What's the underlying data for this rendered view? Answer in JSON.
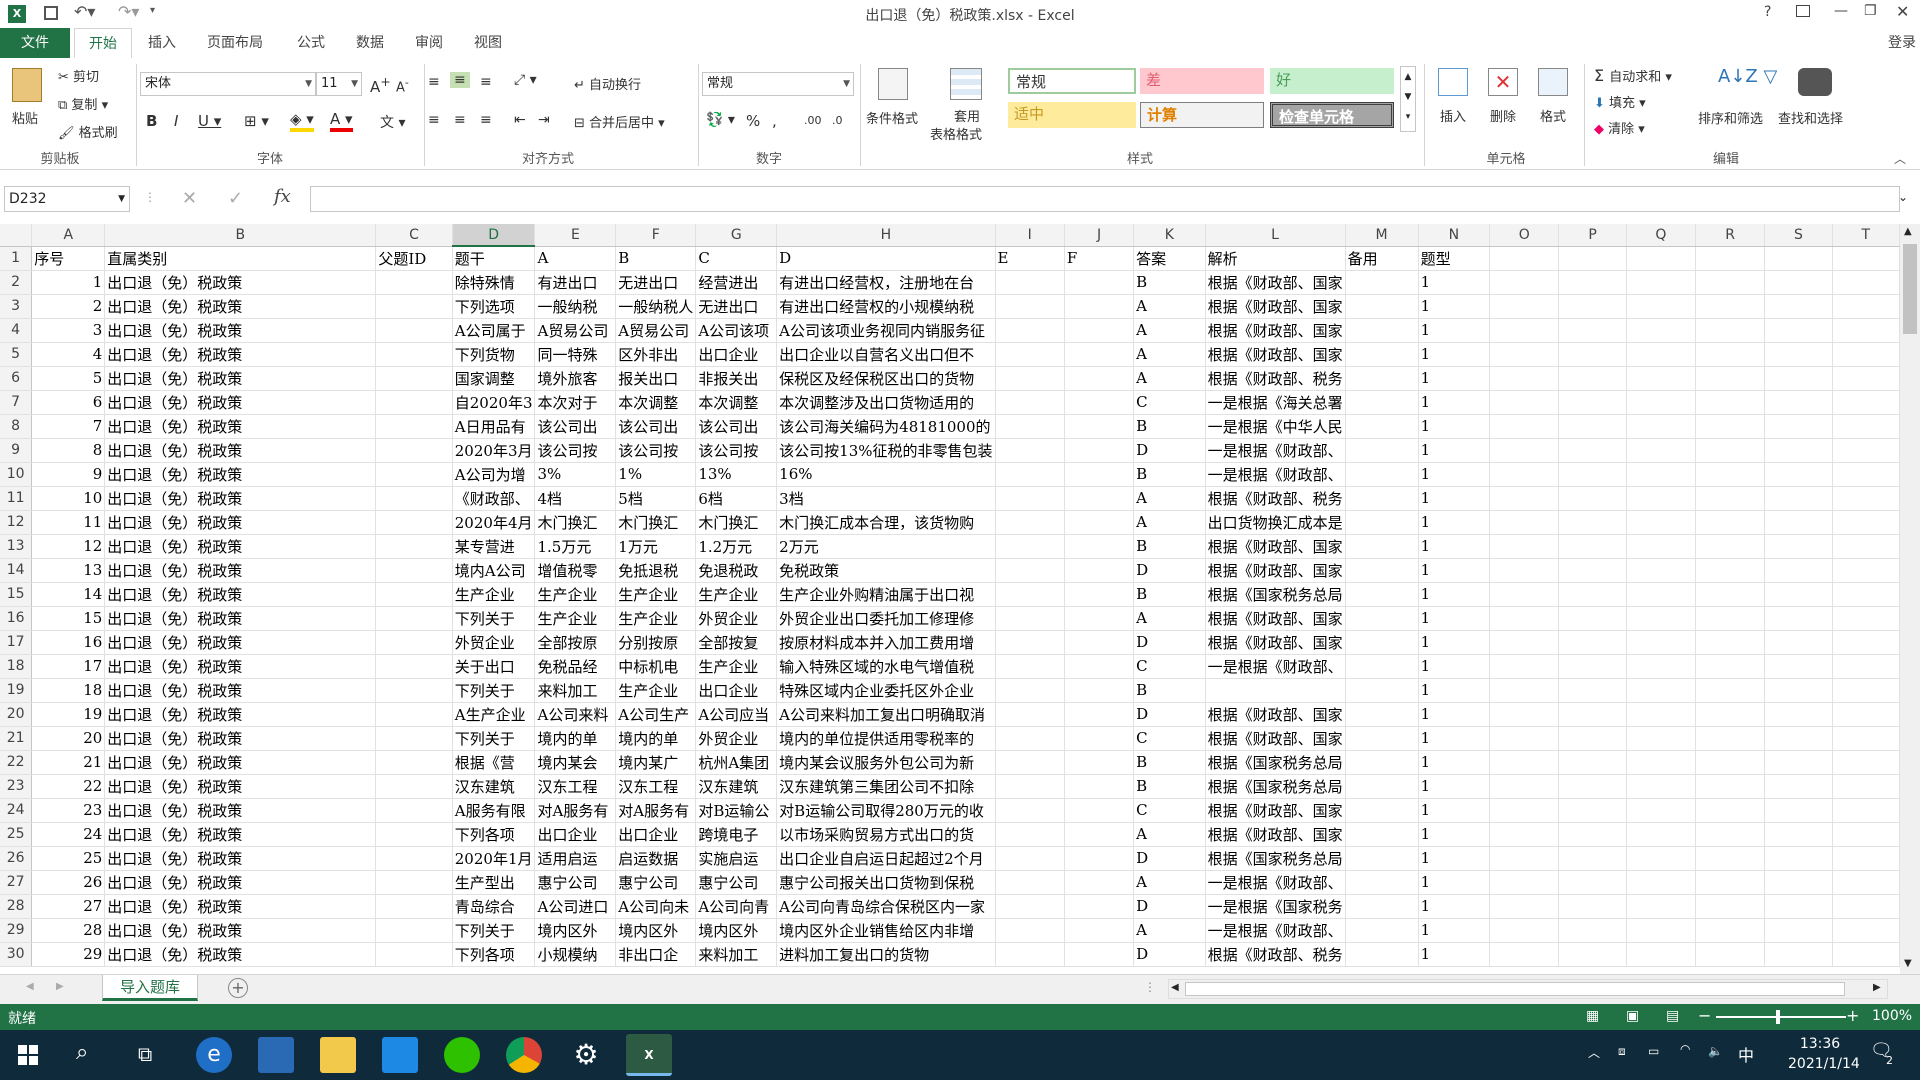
{
  "window": {
    "title": "出口退（免）税政策.xlsx - Excel",
    "signin": "登录"
  },
  "ribbon_tabs": [
    "文件",
    "开始",
    "插入",
    "页面布局",
    "公式",
    "数据",
    "审阅",
    "视图"
  ],
  "clipboard": {
    "paste": "粘贴",
    "cut": "剪切",
    "copy": "复制",
    "format_painter": "格式刷",
    "label": "剪贴板"
  },
  "font": {
    "name": "宋体",
    "size": "11",
    "label": "字体"
  },
  "alignment": {
    "wrap": "自动换行",
    "merge": "合并后居中",
    "label": "对齐方式"
  },
  "number": {
    "format": "常规",
    "label": "数字"
  },
  "styles": {
    "cond_format": "条件格式",
    "table_format_1": "套用",
    "table_format_2": "表格格式",
    "normal": "常规",
    "bad": "差",
    "good": "好",
    "neutral": "适中",
    "calc": "计算",
    "check": "检查单元格",
    "label": "样式"
  },
  "cells": {
    "insert": "插入",
    "delete": "删除",
    "format": "格式",
    "label": "单元格"
  },
  "editing": {
    "autosum": "自动求和",
    "fill": "填充",
    "clear": "清除",
    "sort": "排序和筛选",
    "find": "查找和选择",
    "label": "编辑"
  },
  "formula_bar": {
    "name_box": "D232",
    "value": ""
  },
  "columns": [
    "A",
    "B",
    "C",
    "D",
    "E",
    "F",
    "G",
    "H",
    "I",
    "J",
    "K",
    "L",
    "M",
    "N",
    "O",
    "P",
    "Q",
    "R",
    "S",
    "T"
  ],
  "rows": [
    [
      "序号",
      "直属类别",
      "父题ID",
      "题干",
      "A",
      "B",
      "C",
      "D",
      "E",
      "F",
      "答案",
      "解析",
      "备用",
      "题型"
    ],
    [
      "1",
      "出口退（免）税政策",
      "",
      "除特殊情",
      "有进出口",
      "无进出口",
      "经营进出",
      "有进出口经营权，注册地在台",
      "",
      "",
      "B",
      "根据《财政部、国家",
      "",
      "1"
    ],
    [
      "2",
      "出口退（免）税政策",
      "",
      "下列选项",
      "一般纳税",
      "一般纳税人",
      "无进出口",
      "有进出口经营权的小规模纳税",
      "",
      "",
      "A",
      "根据《财政部、国家",
      "",
      "1"
    ],
    [
      "3",
      "出口退（免）税政策",
      "",
      "A公司属于",
      "A贸易公司",
      "A贸易公司",
      "A公司该项",
      "A公司该项业务视同内销服务征",
      "",
      "",
      "A",
      "根据《财政部、国家",
      "",
      "1"
    ],
    [
      "4",
      "出口退（免）税政策",
      "",
      "下列货物",
      "同一特殊",
      "区外非出",
      "出口企业",
      "出口企业以自营名义出口但不",
      "",
      "",
      "A",
      "根据《财政部、国家",
      "",
      "1"
    ],
    [
      "5",
      "出口退（免）税政策",
      "",
      "国家调整",
      "境外旅客",
      "报关出口",
      "非报关出",
      "保税区及经保税区出口的货物",
      "",
      "",
      "A",
      "根据《财政部、税务",
      "",
      "1"
    ],
    [
      "6",
      "出口退（免）税政策",
      "",
      "自2020年3",
      "本次对于",
      "本次调整",
      "本次调整",
      "本次调整涉及出口货物适用的",
      "",
      "",
      "C",
      "一是根据《海关总署",
      "",
      "1"
    ],
    [
      "7",
      "出口退（免）税政策",
      "",
      "A日用品有",
      "该公司出",
      "该公司出",
      "该公司出",
      "该公司海关编码为48181000的",
      "",
      "",
      "B",
      "一是根据《中华人民",
      "",
      "1"
    ],
    [
      "8",
      "出口退（免）税政策",
      "",
      "2020年3月",
      "该公司按",
      "该公司按",
      "该公司按",
      "该公司按13%征税的非零售包装",
      "",
      "",
      "D",
      "一是根据《财政部、",
      "",
      "1"
    ],
    [
      "9",
      "出口退（免）税政策",
      "",
      "A公司为增",
      "3%",
      "1%",
      "13%",
      "16%",
      "",
      "",
      "B",
      "一是根据《财政部、",
      "",
      "1"
    ],
    [
      "10",
      "出口退（免）税政策",
      "",
      "《财政部、",
      "4档",
      "5档",
      "6档",
      "3档",
      "",
      "",
      "A",
      "根据《财政部、税务",
      "",
      "1"
    ],
    [
      "11",
      "出口退（免）税政策",
      "",
      "2020年4月",
      "木门换汇",
      "木门换汇",
      "木门换汇",
      "木门换汇成本合理，该货物购",
      "",
      "",
      "A",
      "出口货物换汇成本是",
      "",
      "1"
    ],
    [
      "12",
      "出口退（免）税政策",
      "",
      "某专营进",
      "1.5万元",
      "1万元",
      "1.2万元",
      "2万元",
      "",
      "",
      "B",
      "根据《财政部、国家",
      "",
      "1"
    ],
    [
      "13",
      "出口退（免）税政策",
      "",
      "境内A公司",
      "增值税零",
      "免抵退税",
      "免退税政",
      "免税政策",
      "",
      "",
      "D",
      "根据《财政部、国家",
      "",
      "1"
    ],
    [
      "14",
      "出口退（免）税政策",
      "",
      "生产企业",
      "生产企业",
      "生产企业",
      "生产企业",
      "生产企业外购精油属于出口视",
      "",
      "",
      "B",
      "根据《国家税务总局",
      "",
      "1"
    ],
    [
      "15",
      "出口退（免）税政策",
      "",
      "下列关于",
      "生产企业",
      "生产企业",
      "外贸企业",
      "外贸企业出口委托加工修理修",
      "",
      "",
      "A",
      "根据《财政部、国家",
      "",
      "1"
    ],
    [
      "16",
      "出口退（免）税政策",
      "",
      "外贸企业",
      "全部按原",
      "分别按原",
      "全部按复",
      "按原材料成本并入加工费用增",
      "",
      "",
      "D",
      "根据《财政部、国家",
      "",
      "1"
    ],
    [
      "17",
      "出口退（免）税政策",
      "",
      "关于出口",
      "免税品经",
      "中标机电",
      "生产企业",
      "输入特殊区域的水电气增值税",
      "",
      "",
      "C",
      "一是根据《财政部、",
      "",
      "1"
    ],
    [
      "18",
      "出口退（免）税政策",
      "",
      "下列关于",
      "来料加工",
      "生产企业",
      "出口企业",
      "特殊区域内企业委托区外企业",
      "",
      "",
      "B",
      "",
      "",
      "1"
    ],
    [
      "19",
      "出口退（免）税政策",
      "",
      "A生产企业",
      "A公司来料",
      "A公司生产",
      "A公司应当",
      "A公司来料加工复出口明确取消",
      "",
      "",
      "D",
      "根据《财政部、国家",
      "",
      "1"
    ],
    [
      "20",
      "出口退（免）税政策",
      "",
      "下列关于",
      "境内的单",
      "境内的单",
      "外贸企业",
      "境内的单位提供适用零税率的",
      "",
      "",
      "C",
      "根据《财政部、国家",
      "",
      "1"
    ],
    [
      "21",
      "出口退（免）税政策",
      "",
      "根据《营",
      "境内某会",
      "境内某广",
      "杭州A集团",
      "境内某会议服务外包公司为新",
      "",
      "",
      "B",
      "根据《国家税务总局",
      "",
      "1"
    ],
    [
      "22",
      "出口退（免）税政策",
      "",
      "汉东建筑",
      "汉东工程",
      "汉东工程",
      "汉东建筑",
      "汉东建筑第三集团公司不扣除",
      "",
      "",
      "B",
      "根据《国家税务总局",
      "",
      "1"
    ],
    [
      "23",
      "出口退（免）税政策",
      "",
      "A服务有限",
      "对A服务有",
      "对A服务有",
      "对B运输公",
      "对B运输公司取得280万元的收",
      "",
      "",
      "C",
      "根据《财政部、国家",
      "",
      "1"
    ],
    [
      "24",
      "出口退（免）税政策",
      "",
      "下列各项",
      "出口企业",
      "出口企业",
      "跨境电子",
      "以市场采购贸易方式出口的货",
      "",
      "",
      "A",
      "根据《财政部、国家",
      "",
      "1"
    ],
    [
      "25",
      "出口退（免）税政策",
      "",
      "2020年1月",
      "适用启运",
      "启运数据",
      "实施启运",
      "出口企业自启运日起超过2个月",
      "",
      "",
      "D",
      "根据《国家税务总局",
      "",
      "1"
    ],
    [
      "26",
      "出口退（免）税政策",
      "",
      "生产型出",
      "惠宁公司",
      "惠宁公司",
      "惠宁公司",
      "惠宁公司报关出口货物到保税",
      "",
      "",
      "A",
      "一是根据《财政部、",
      "",
      "1"
    ],
    [
      "27",
      "出口退（免）税政策",
      "",
      "青岛综合",
      "A公司进口",
      "A公司向未",
      "A公司向青",
      "A公司向青岛综合保税区内一家",
      "",
      "",
      "D",
      "一是根据《国家税务",
      "",
      "1"
    ],
    [
      "28",
      "出口退（免）税政策",
      "",
      "下列关于",
      "境内区外",
      "境内区外",
      "境内区外",
      "境内区外企业销售给区内非增",
      "",
      "",
      "A",
      "一是根据《财政部、",
      "",
      "1"
    ],
    [
      "29",
      "出口退（免）税政策",
      "",
      "下列各项",
      "小规模纳",
      "非出口企",
      "来料加工",
      "进料加工复出口的货物",
      "",
      "",
      "D",
      "根据《财政部、税务",
      "",
      "1"
    ]
  ],
  "sheet_tab": "导入题库",
  "status": {
    "ready": "就绪",
    "zoom": "100%"
  },
  "taskbar": {
    "time": "13:36",
    "date": "2021/1/14",
    "ime": "中",
    "notif": "2"
  }
}
